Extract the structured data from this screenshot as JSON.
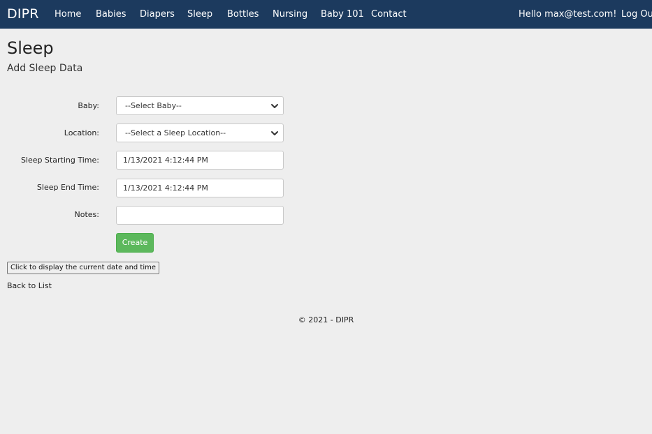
{
  "navbar": {
    "brand": "DIPR",
    "links": [
      "Home",
      "Babies",
      "Diapers",
      "Sleep",
      "Bottles",
      "Nursing",
      "Baby 101",
      "Contact"
    ],
    "greeting": "Hello max@test.com!",
    "logout": "Log Out"
  },
  "page": {
    "title": "Sleep",
    "subtitle": "Add Sleep Data"
  },
  "form": {
    "baby_label": "Baby:",
    "baby_value": "--Select Baby--",
    "location_label": "Location:",
    "location_value": "--Select a Sleep Location--",
    "start_label": "Sleep Starting Time:",
    "start_value": "1/13/2021 4:12:44 PM",
    "end_label": "Sleep End Time:",
    "end_value": "1/13/2021 4:12:44 PM",
    "notes_label": "Notes:",
    "notes_value": "",
    "create_label": "Create"
  },
  "display_button_label": "Click to display the current date and time",
  "back_link": "Back to List",
  "footer": "© 2021 - DIPR",
  "colors": {
    "navbar_bg": "#1c3a5e",
    "create_button": "#5cb85c",
    "page_bg": "#eeeeee"
  },
  "icons": {
    "select_arrow": "chevron-down-icon"
  }
}
